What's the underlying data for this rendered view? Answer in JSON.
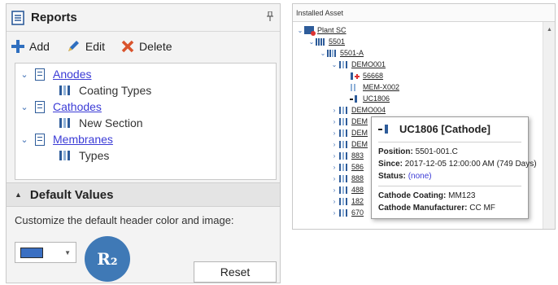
{
  "reports_panel": {
    "title": "Reports",
    "pin_icon": "pin-icon",
    "toolbar": {
      "add_label": "Add",
      "edit_label": "Edit",
      "delete_label": "Delete"
    },
    "tree": [
      {
        "label": "Anodes",
        "child": "Coating Types"
      },
      {
        "label": "Cathodes",
        "child": "New Section"
      },
      {
        "label": "Membranes",
        "child": "Types"
      }
    ],
    "default_values": {
      "header": "Default Values",
      "description": "Customize the default header color and image:",
      "swatch_color": "#3a6fc2",
      "logo_text": "R₂",
      "reset_label": "Reset"
    }
  },
  "asset_panel": {
    "header": "Installed Asset",
    "nodes": {
      "plant": "Plant SC",
      "n5501": "5501",
      "n5501a": "5501-A",
      "demo001": "DEMO001",
      "c56668": "56668",
      "mem": "MEM-X002",
      "uc1806": "UC1806",
      "rows": [
        "DEMO004",
        "DEM",
        "DEM",
        "DEM",
        "883",
        "586",
        "888",
        "488",
        "182",
        "670"
      ]
    },
    "tooltip": {
      "title": "UC1806 [Cathode]",
      "position_label": "Position:",
      "position_value": "5501-001.C",
      "since_label": "Since:",
      "since_value": "2017-12-05 12:00:00 AM (749 Days)",
      "status_label": "Status:",
      "status_value": "(none)",
      "coating_label": "Cathode Coating:",
      "coating_value": "MM123",
      "manufacturer_label": "Cathode Manufacturer:",
      "manufacturer_value": "CC MF"
    }
  }
}
